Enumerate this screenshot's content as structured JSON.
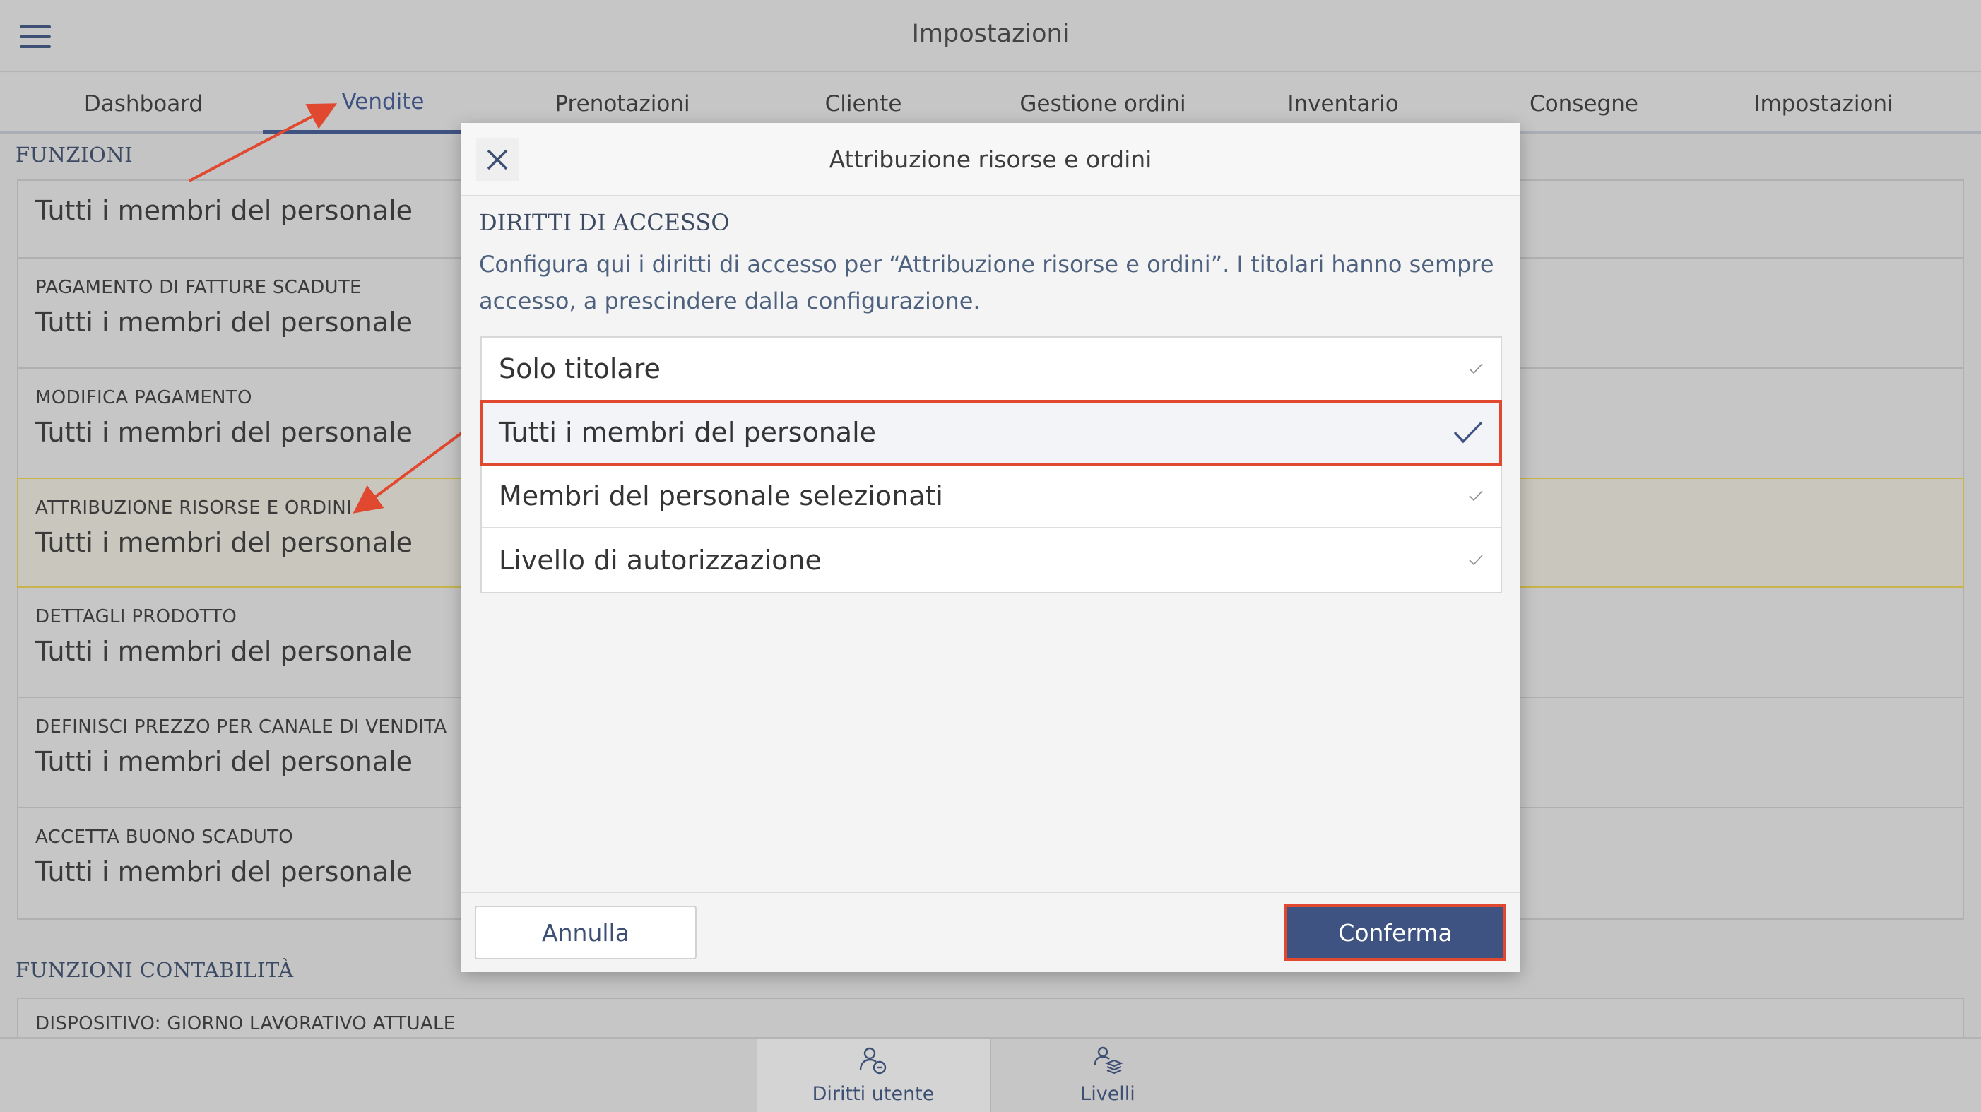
{
  "header": {
    "title": "Impostazioni"
  },
  "tabs": [
    {
      "label": "Dashboard"
    },
    {
      "label": "Vendite"
    },
    {
      "label": "Prenotazioni"
    },
    {
      "label": "Cliente"
    },
    {
      "label": "Gestione ordini"
    },
    {
      "label": "Inventario"
    },
    {
      "label": "Consegne"
    },
    {
      "label": "Impostazioni"
    }
  ],
  "functions": {
    "heading": "FUNZIONI",
    "rows": [
      {
        "label": "",
        "value": "Tutti i membri del personale"
      },
      {
        "label": "PAGAMENTO DI FATTURE SCADUTE",
        "value": "Tutti i membri del personale"
      },
      {
        "label": "MODIFICA PAGAMENTO",
        "value": "Tutti i membri del personale"
      },
      {
        "label": "ATTRIBUZIONE RISORSE E ORDINI",
        "value": "Tutti i membri del personale"
      },
      {
        "label": "DETTAGLI PRODOTTO",
        "value": "Tutti i membri del personale"
      },
      {
        "label": "DEFINISCI PREZZO PER CANALE DI VENDITA",
        "value": "Tutti i membri del personale"
      },
      {
        "label": "ACCETTA BUONO SCADUTO",
        "value": "Tutti i membri del personale"
      }
    ]
  },
  "accounting": {
    "heading": "FUNZIONI CONTABILITÀ",
    "rows": [
      {
        "label": "DISPOSITIVO: GIORNO LAVORATIVO ATTUALE"
      }
    ]
  },
  "bottom_tabs": [
    {
      "label": "Diritti utente",
      "icon": "user-key-icon"
    },
    {
      "label": "Livelli",
      "icon": "levels-icon"
    }
  ],
  "modal": {
    "title": "Attribuzione risorse e ordini",
    "heading": "DIRITTI DI ACCESSO",
    "description": "Configura qui i diritti di accesso per “Attribuzione risorse e ordini”. I titolari hanno sempre accesso, a prescindere dalla configurazione.",
    "options": [
      {
        "label": "Solo titolare"
      },
      {
        "label": "Tutti i membri del personale"
      },
      {
        "label": "Membri del personale selezionati"
      },
      {
        "label": "Livello di autorizzazione"
      }
    ],
    "selected_index": 1,
    "cancel_label": "Annulla",
    "confirm_label": "Conferma"
  },
  "colors": {
    "brand": "#3f5382",
    "highlight": "#e0482f",
    "row_highlight_border": "#c8b44c"
  }
}
